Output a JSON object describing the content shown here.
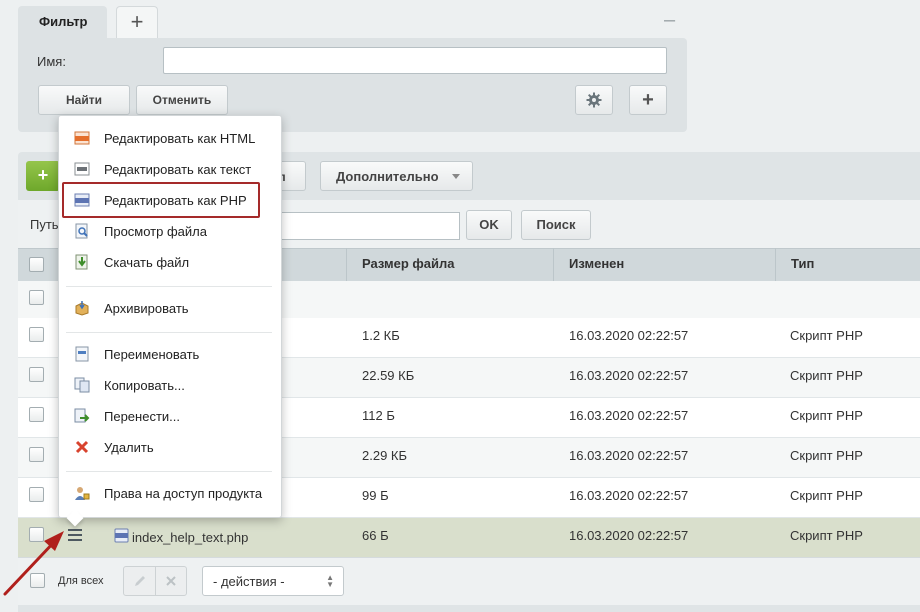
{
  "filter": {
    "tab_label": "Фильтр",
    "add_tab": "+",
    "minimize": "–",
    "name_label": "Имя:",
    "name_value": "",
    "find_button": "Найти",
    "cancel_button": "Отменить",
    "add_button": "+"
  },
  "toolbar": {
    "add_button": "+",
    "partial_label": "л",
    "more_button": "Дополнительно"
  },
  "path": {
    "label": "Путь",
    "value": "",
    "ok_button": "OK",
    "search_button": "Поиск"
  },
  "columns": [
    "Размер файла",
    "Изменен",
    "Тип"
  ],
  "rows": [
    {
      "name": "",
      "size": "",
      "modified": "",
      "type": ""
    },
    {
      "name": "",
      "size": "1.2 КБ",
      "modified": "16.03.2020 02:22:57",
      "type": "Скрипт PHP"
    },
    {
      "name": "",
      "size": "22.59 КБ",
      "modified": "16.03.2020 02:22:57",
      "type": "Скрипт PHP"
    },
    {
      "name": "",
      "size": "112 Б",
      "modified": "16.03.2020 02:22:57",
      "type": "Скрипт PHP"
    },
    {
      "name": "",
      "size": "2.29 КБ",
      "modified": "16.03.2020 02:22:57",
      "type": "Скрипт PHP"
    },
    {
      "name": "",
      "size": "99 Б",
      "modified": "16.03.2020 02:22:57",
      "type": "Скрипт PHP"
    },
    {
      "name": "index_help_text.php",
      "size": "66 Б",
      "modified": "16.03.2020 02:22:57",
      "type": "Скрипт PHP"
    }
  ],
  "footer": {
    "for_all": "Для всех",
    "actions_select": "- действия -"
  },
  "menu": {
    "items": [
      {
        "label": "Редактировать как HTML",
        "icon": "edit-html-icon"
      },
      {
        "label": "Редактировать как текст",
        "icon": "edit-text-icon"
      },
      {
        "label": "Редактировать как PHP",
        "icon": "edit-php-icon"
      },
      {
        "label": "Просмотр файла",
        "icon": "view-file-icon"
      },
      {
        "label": "Скачать файл",
        "icon": "download-file-icon"
      },
      {
        "label": "Архивировать",
        "icon": "archive-icon"
      },
      {
        "label": "Переименовать",
        "icon": "rename-icon"
      },
      {
        "label": "Копировать...",
        "icon": "copy-icon"
      },
      {
        "label": "Перенести...",
        "icon": "move-icon"
      },
      {
        "label": "Удалить",
        "icon": "delete-icon"
      },
      {
        "label": "Права на доступ продукта",
        "icon": "access-rights-icon"
      }
    ]
  },
  "colors": {
    "highlight_box": "#a52a2a",
    "add_button": "#7ab536",
    "selected_row": "#d9dfcc",
    "arrow": "#b0201c"
  }
}
